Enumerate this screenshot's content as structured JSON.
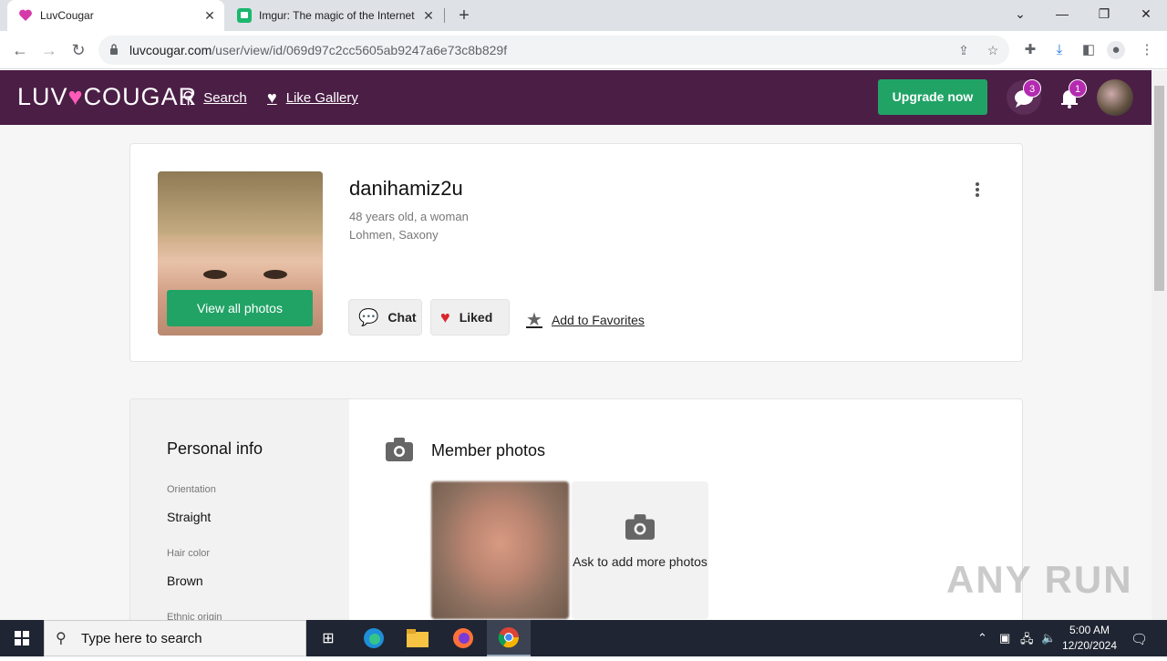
{
  "browser": {
    "tabs": [
      {
        "title": "LuvCougar",
        "active": true
      },
      {
        "title": "Imgur: The magic of the Internet",
        "active": false
      }
    ],
    "url_host": "luvcougar.com",
    "url_path": "/user/view/id/069d97c2cc5605ab9247a6e73c8b829f"
  },
  "site": {
    "logo_left": "LUV",
    "logo_right": "COUGAR",
    "nav": {
      "search": "Search",
      "like_gallery": "Like Gallery"
    },
    "upgrade_label": "Upgrade now",
    "messages_badge": "3",
    "notifications_badge": "1"
  },
  "profile": {
    "username": "danihamiz2u",
    "age_gender": "48 years old, a woman",
    "location": "Lohmen, Saxony",
    "view_all_photos": "View all photos",
    "chat_label": "Chat",
    "liked_label": "Liked",
    "favorites_label": "Add to Favorites"
  },
  "personal_info": {
    "title": "Personal info",
    "fields": [
      {
        "label": "Orientation",
        "value": "Straight"
      },
      {
        "label": "Hair color",
        "value": "Brown"
      },
      {
        "label": "Ethnic origin",
        "value": ""
      }
    ]
  },
  "member_photos": {
    "title": "Member photos",
    "ask_more": "Ask to add more photos"
  },
  "watermark": "ANY RUN",
  "taskbar": {
    "search_placeholder": "Type here to search",
    "time": "5:00 AM",
    "date": "12/20/2024"
  },
  "colors": {
    "header_bg": "#4b1e46",
    "accent_green": "#21a366",
    "badge": "#b42ab0"
  }
}
